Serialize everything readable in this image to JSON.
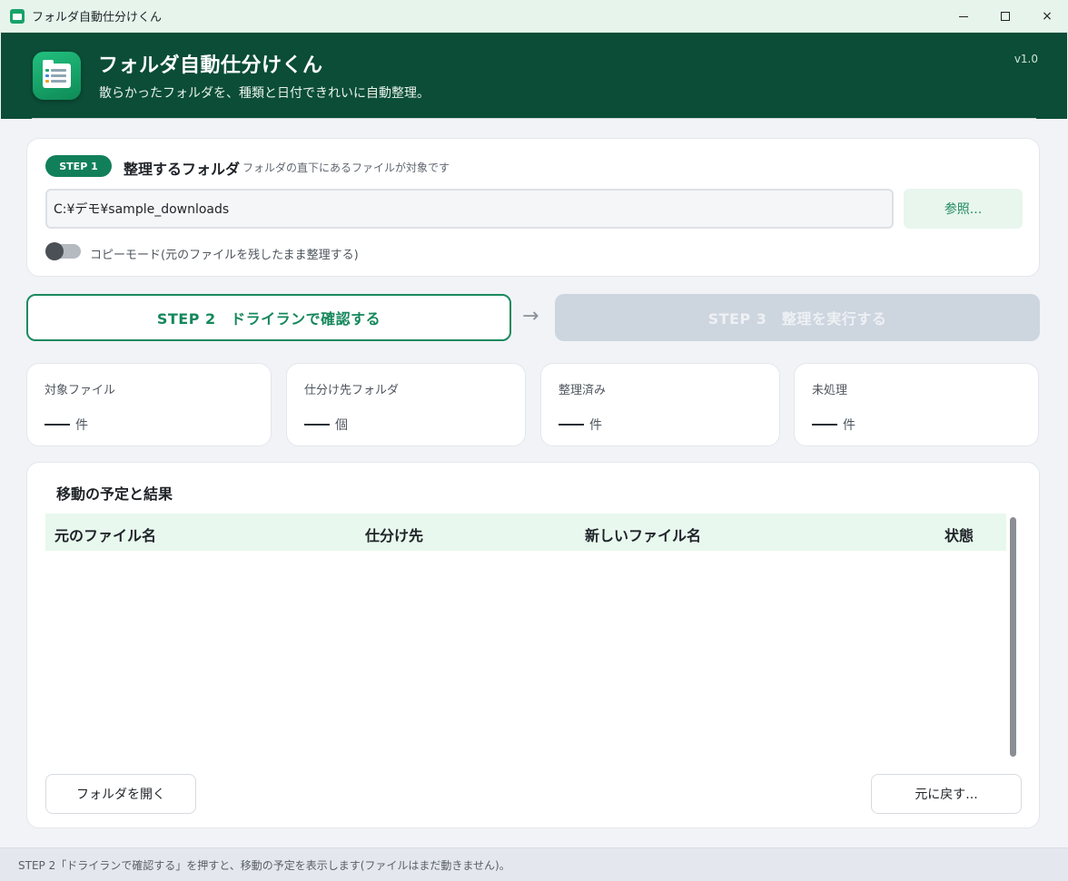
{
  "window": {
    "title": "フォルダ自動仕分けくん",
    "controls": {
      "minimize": "minimize-icon",
      "maximize": "maximize-icon",
      "close": "×"
    }
  },
  "header": {
    "title": "フォルダ自動仕分けくん",
    "subtitle": "散らかったフォルダを、種類と日付できれいに自動整理。",
    "version": "v1.0",
    "logo_icon": "folder-list-icon"
  },
  "step1": {
    "badge": "STEP 1",
    "title": "整理するフォルダ",
    "description": "フォルダの直下にあるファイルが対象です",
    "path_value": "C:¥デモ¥sample_downloads",
    "browse_label": "参照...",
    "copy_mode_label": "コピーモード(元のファイルを残したまま整理する)",
    "copy_mode_on": false
  },
  "actions": {
    "step2_label": "STEP 2　ドライランで確認する",
    "arrow": "→",
    "step3_label": "STEP 3　整理を実行する",
    "step3_enabled": false
  },
  "stats": [
    {
      "label": "対象ファイル",
      "unit": "件"
    },
    {
      "label": "仕分け先フォルダ",
      "unit": "個"
    },
    {
      "label": "整理済み",
      "unit": "件"
    },
    {
      "label": "未処理",
      "unit": "件"
    }
  ],
  "results": {
    "title": "移動の予定と結果",
    "columns": [
      "元のファイル名",
      "仕分け先",
      "新しいファイル名",
      "状態"
    ],
    "rows": [],
    "open_folder_label": "フォルダを開く",
    "undo_label": "元に戻す..."
  },
  "status": {
    "text": "STEP 2「ドライランで確認する」を押すと、移動の予定を表示します(ファイルはまだ動きません)。"
  },
  "colors": {
    "header_bg": "#0b4d37",
    "accent": "#15885c",
    "disabled": "#cdd5df",
    "table_header_bg": "#e8f8ee"
  }
}
